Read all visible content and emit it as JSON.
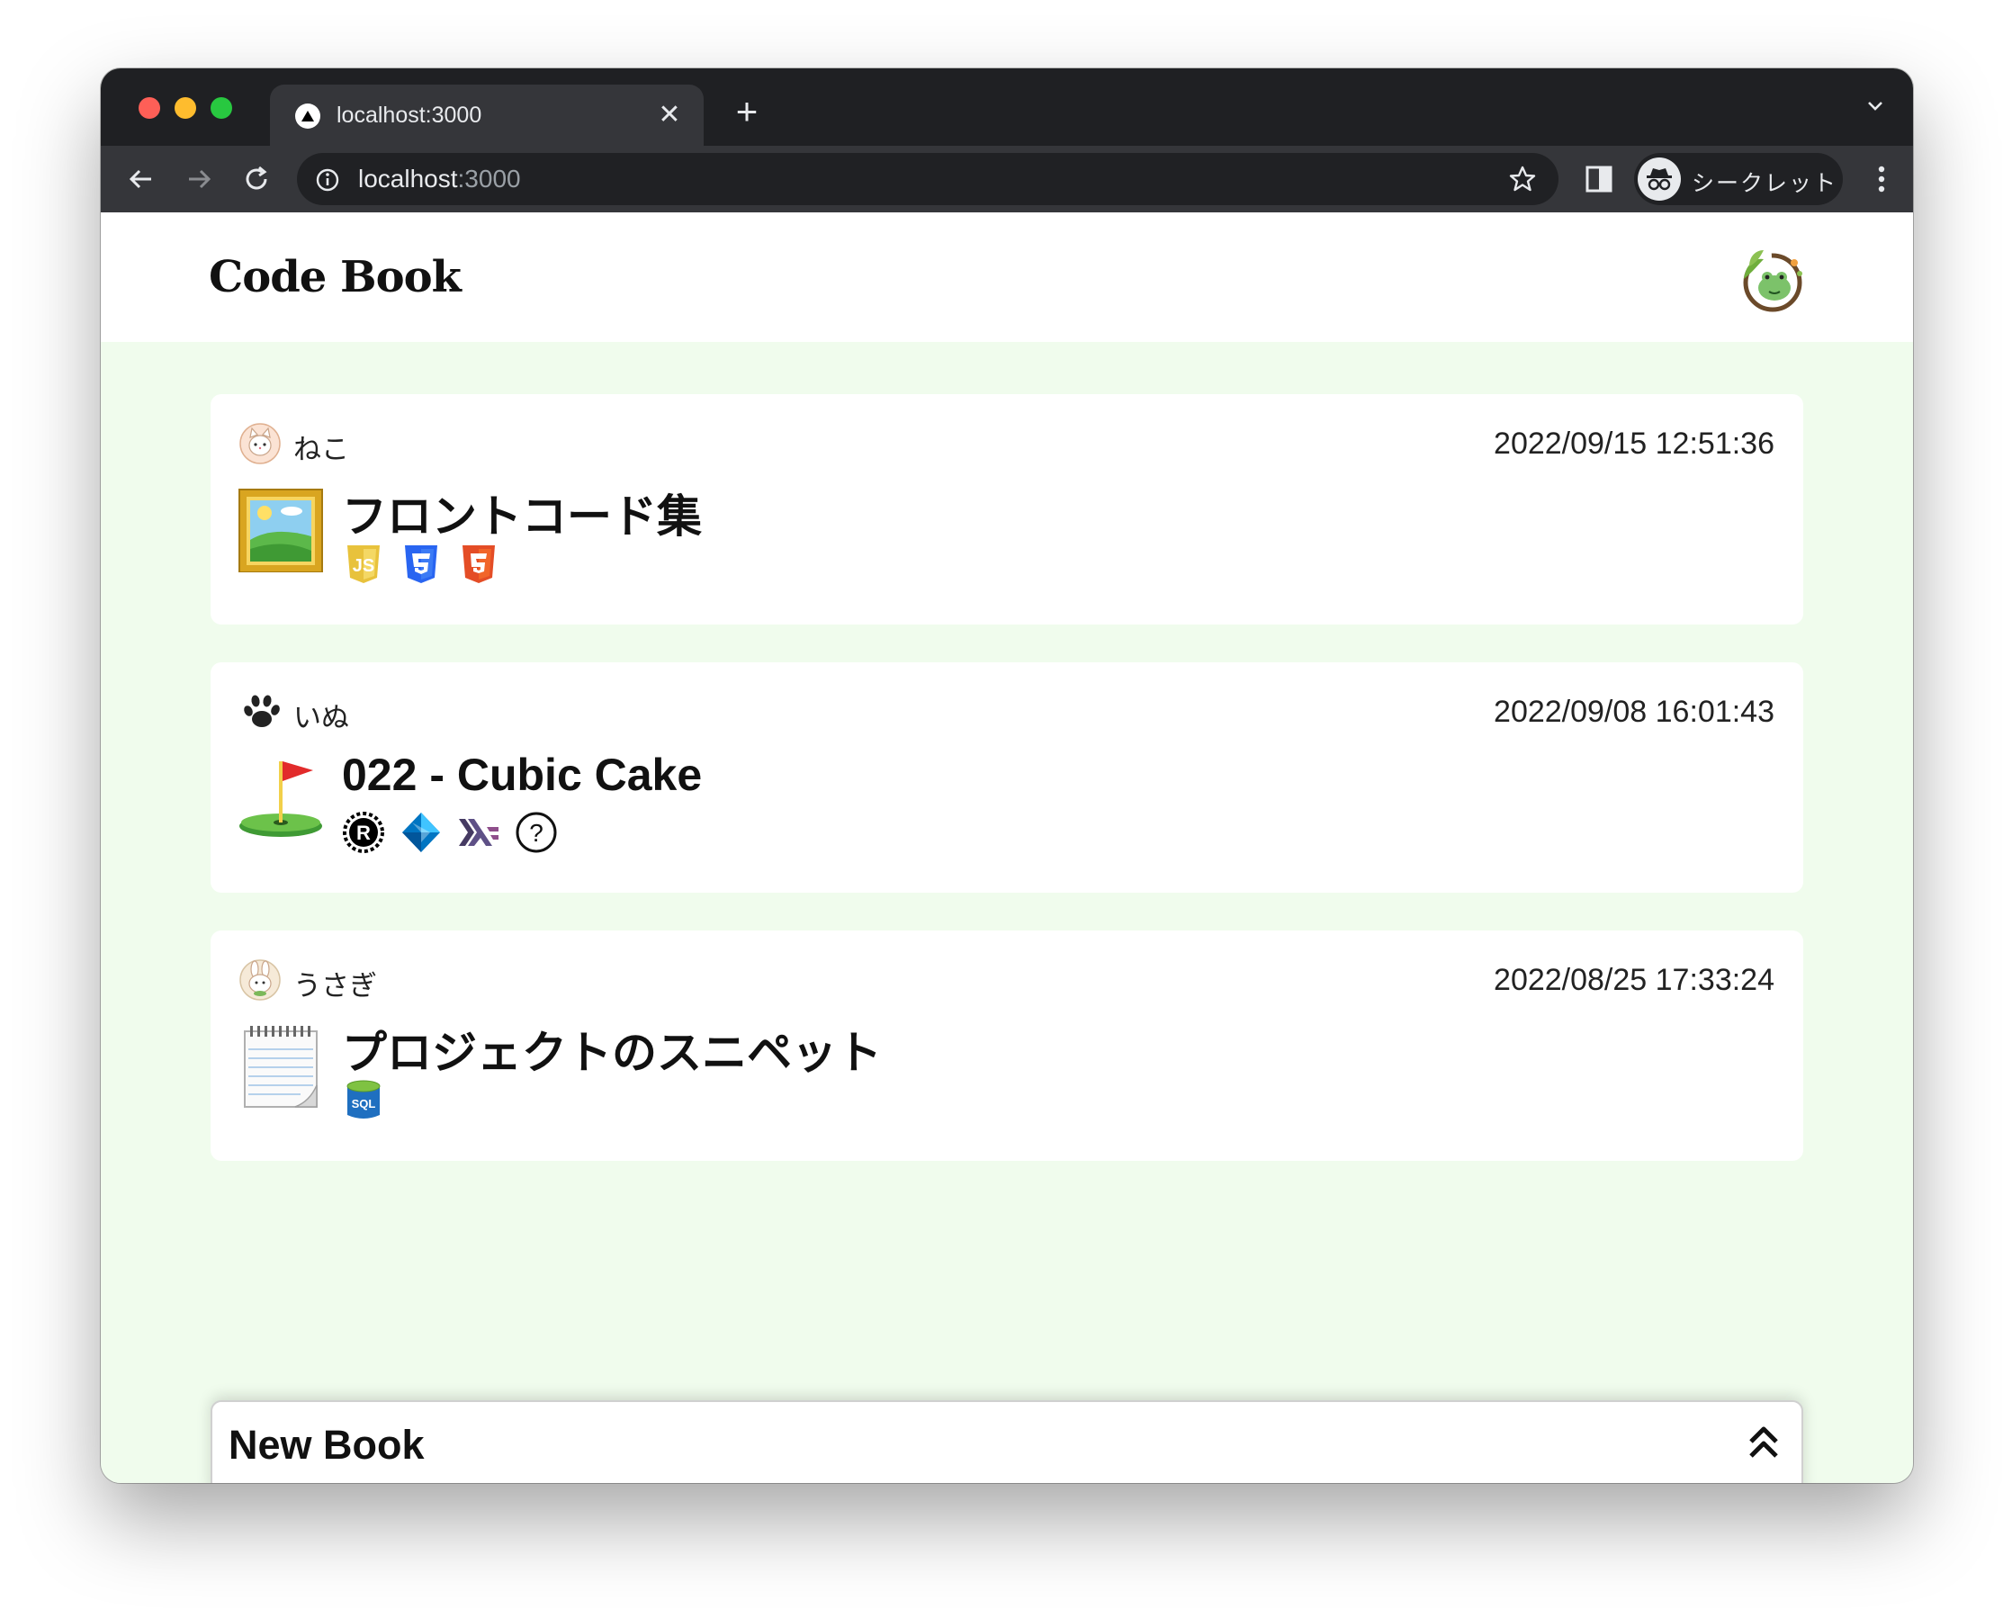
{
  "browser": {
    "tab_title": "localhost:3000",
    "tab_close": "✕",
    "new_tab": "+",
    "url_host": "localhost",
    "url_port": ":3000",
    "profile_label": "シークレット"
  },
  "site": {
    "title": "Code Book"
  },
  "books": [
    {
      "author": "ねこ",
      "date": "2022/09/15 12:51:36",
      "title": "フロントコード集",
      "emoji": "framed-picture-icon",
      "languages": [
        "javascript-icon",
        "css3-icon",
        "html5-icon"
      ]
    },
    {
      "author": "いぬ",
      "date": "2022/09/08 16:01:43",
      "title": "022 - Cubic Cake",
      "emoji": "golf-flag-icon",
      "languages": [
        "rust-icon",
        "dart-icon",
        "haskell-icon",
        "unknown-icon"
      ]
    },
    {
      "author": "うさぎ",
      "date": "2022/08/25 17:33:24",
      "title": "プロジェクトのスニペット",
      "emoji": "notepad-icon",
      "languages": [
        "sql-icon"
      ]
    }
  ],
  "new_book": {
    "label": "New Book"
  },
  "colors": {
    "page_bg": "#f0fced",
    "card_bg": "#ffffff",
    "chrome_dark": "#1f2023",
    "chrome_toolbar": "#35363a"
  }
}
